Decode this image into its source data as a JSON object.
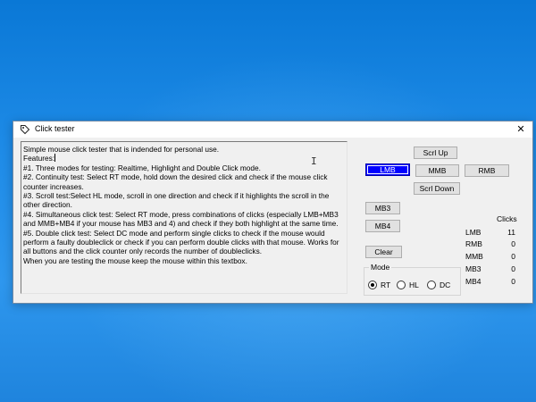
{
  "window": {
    "title": "Click tester",
    "close_glyph": "✕"
  },
  "textbox": {
    "lines": [
      "Simple mouse click tester that is indended for personal use.",
      "Features:",
      "#1. Three modes for testing: Realtime, Highlight and Double Click mode.",
      "#2. Continuity test: Select RT mode, hold down the desired click and check if the mouse click counter increases.",
      "#3. Scroll test:Select HL mode, scroll in one direction and check if it highlights the scroll in the other direction.",
      "#4. Simultaneous click test: Select RT mode, press combinations of clicks (especially LMB+MB3 and MMB+MB4 if your mouse has MB3 and 4) and check if they both highlight at the same time.",
      "#5. Double click test: Select DC mode and perform single clicks to check if the mouse would perform a faulty doubleclick or check if you can perform double clicks with that mouse. Works for all buttons and the click counter only records the number of doubleclicks.",
      " When you are testing the mouse keep the mouse within this textbox."
    ]
  },
  "buttons": {
    "scroll_up": "Scrl Up",
    "lmb": "LMB",
    "mmb": "MMB",
    "rmb": "RMB",
    "scroll_down": "Scrl Down",
    "mb3": "MB3",
    "mb4": "MB4",
    "clear": "Clear"
  },
  "mode": {
    "legend": "Mode",
    "options": [
      {
        "label": "RT",
        "checked": true
      },
      {
        "label": "HL",
        "checked": false
      },
      {
        "label": "DC",
        "checked": false
      }
    ]
  },
  "clicks": {
    "header": "Clicks",
    "rows": [
      {
        "label": "LMB",
        "value": "11"
      },
      {
        "label": "RMB",
        "value": "0"
      },
      {
        "label": "MMB",
        "value": "0"
      },
      {
        "label": "MB3",
        "value": "0"
      },
      {
        "label": "MB4",
        "value": "0"
      }
    ]
  },
  "colors": {
    "highlight": "#0000ff",
    "desktop": "#1d8ae6"
  },
  "icons": {
    "app": "tag-icon",
    "close": "close-icon"
  }
}
